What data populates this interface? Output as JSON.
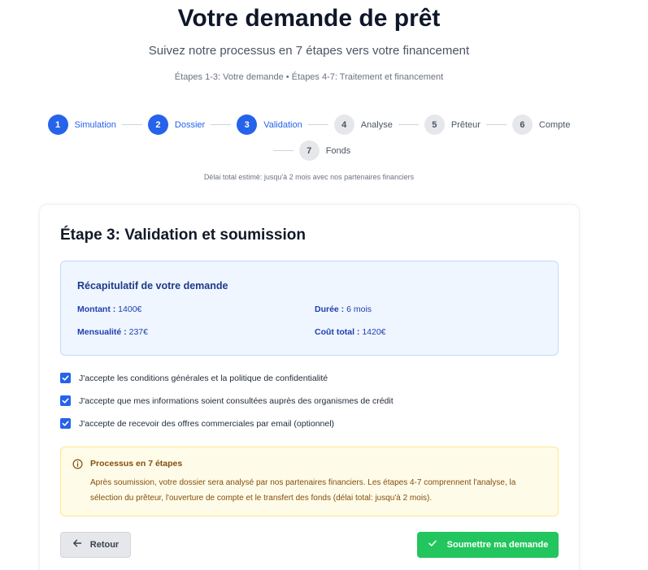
{
  "header": {
    "title": "Votre demande de prêt",
    "subtitle": "Suivez notre processus en 7 étapes vers votre financement",
    "caption": "Étapes 1-3: Votre demande • Étapes 4-7: Traitement et financement"
  },
  "stepper": {
    "steps": [
      {
        "num": "1",
        "label": "Simulation",
        "state": "active"
      },
      {
        "num": "2",
        "label": "Dossier",
        "state": "active"
      },
      {
        "num": "3",
        "label": "Validation",
        "state": "active"
      },
      {
        "num": "4",
        "label": "Analyse",
        "state": "inactive"
      },
      {
        "num": "5",
        "label": "Prêteur",
        "state": "inactive"
      },
      {
        "num": "6",
        "label": "Compte",
        "state": "inactive"
      },
      {
        "num": "7",
        "label": "Fonds",
        "state": "inactive"
      }
    ],
    "delay_note": "Délai total estimé: jusqu'à 2 mois avec nos partenaires financiers"
  },
  "card": {
    "title": "Étape 3: Validation et soumission",
    "summary": {
      "title": "Récapitulatif de votre demande",
      "amount_key": "Montant :",
      "amount_value": "1400€",
      "duration_key": "Durée :",
      "duration_value": "6 mois",
      "monthly_key": "Mensualité :",
      "monthly_value": "237€",
      "total_key": "Coût total :",
      "total_value": "1420€"
    },
    "consents": [
      {
        "label": "J'accepte les conditions générales et la politique de confidentialité",
        "checked": true
      },
      {
        "label": "J'accepte que mes informations soient consultées auprès des organismes de crédit",
        "checked": true
      },
      {
        "label": "J'accepte de recevoir des offres commerciales par email (optionnel)",
        "checked": true
      }
    ],
    "info": {
      "icon": "info-icon",
      "title": "Processus en 7 étapes",
      "text": "Après soumission, votre dossier sera analysé par nos partenaires financiers. Les étapes 4-7 comprennent l'analyse, la sélection du prêteur, l'ouverture de compte et le transfert des fonds (délai total: jusqu'à 2 mois)."
    },
    "buttons": {
      "back_label": "Retour",
      "back_icon": "arrow-left-icon",
      "submit_label": "Soumettre ma demande",
      "submit_icon": "check-icon"
    }
  },
  "colors": {
    "primary": "#2563eb",
    "success": "#22c55e",
    "summary_bg": "#eff6ff",
    "info_bg": "#fefce8"
  }
}
